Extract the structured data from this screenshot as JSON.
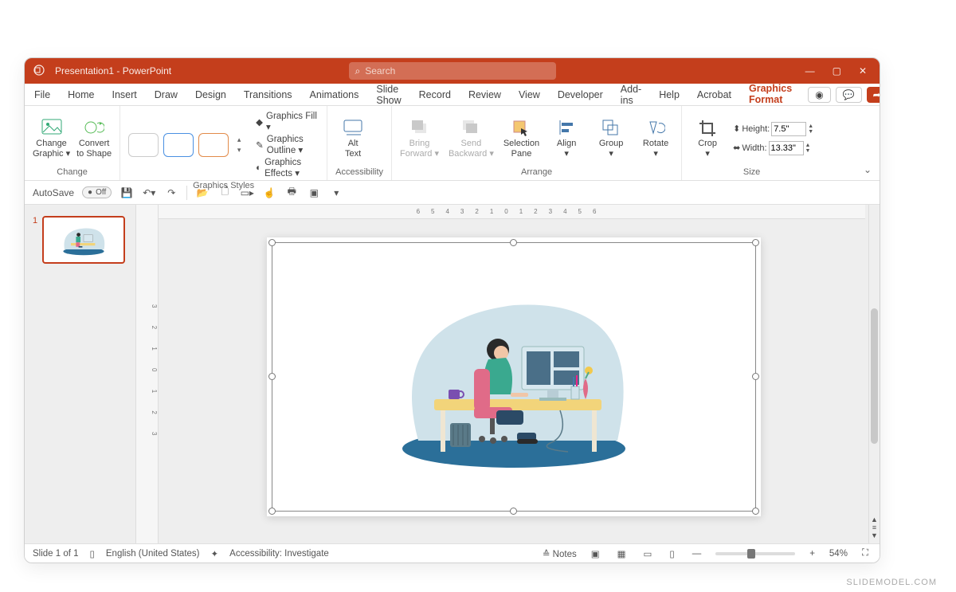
{
  "title": "Presentation1 - PowerPoint",
  "search": {
    "placeholder": "Search"
  },
  "window_buttons": {
    "min": "—",
    "max": "▢",
    "close": "✕"
  },
  "menu": {
    "tabs": [
      "File",
      "Home",
      "Insert",
      "Draw",
      "Design",
      "Transitions",
      "Animations",
      "Slide Show",
      "Record",
      "Review",
      "View",
      "Developer",
      "Add-ins",
      "Help",
      "Acrobat",
      "Graphics Format"
    ],
    "active": "Graphics Format",
    "camera_icon": "◉",
    "comment_icon": "💬",
    "share_icon": "➦▾"
  },
  "ribbon": {
    "change": {
      "change_graphic": "Change\nGraphic ▾",
      "convert": "Convert\nto Shape",
      "label": "Change"
    },
    "styles": {
      "fill": "Graphics Fill ▾",
      "outline": "Graphics Outline ▾",
      "effects": "Graphics Effects ▾",
      "label": "Graphics Styles"
    },
    "accessibility": {
      "alt_text": "Alt\nText",
      "label": "Accessibility"
    },
    "arrange": {
      "bring_forward": "Bring\nForward ▾",
      "send_backward": "Send\nBackward ▾",
      "selection_pane": "Selection\nPane",
      "align": "Align\n▾",
      "group": "Group\n▾",
      "rotate": "Rotate\n▾",
      "label": "Arrange"
    },
    "size": {
      "crop": "Crop\n▾",
      "height_label": "Height:",
      "height_value": "7.5\"",
      "width_label": "Width:",
      "width_value": "13.33\"",
      "label": "Size"
    }
  },
  "qat": {
    "autosave": "AutoSave",
    "autosave_state": "Off",
    "items": [
      "save",
      "undo",
      "redo",
      "|",
      "open",
      "new",
      "from-begin",
      "touch",
      "quick-print",
      "layout",
      "more"
    ]
  },
  "ruler": {
    "h": "6543210123456",
    "v": "3 2 1 0 1 2 3"
  },
  "thumb": {
    "index": "1"
  },
  "status": {
    "slide": "Slide 1 of 1",
    "lang": "English (United States)",
    "accessibility": "Accessibility: Investigate",
    "notes": "Notes",
    "zoom": "54%",
    "plus": "+",
    "minus": "—",
    "fit": "⛶"
  },
  "watermark": "SLIDEMODEL.COM"
}
